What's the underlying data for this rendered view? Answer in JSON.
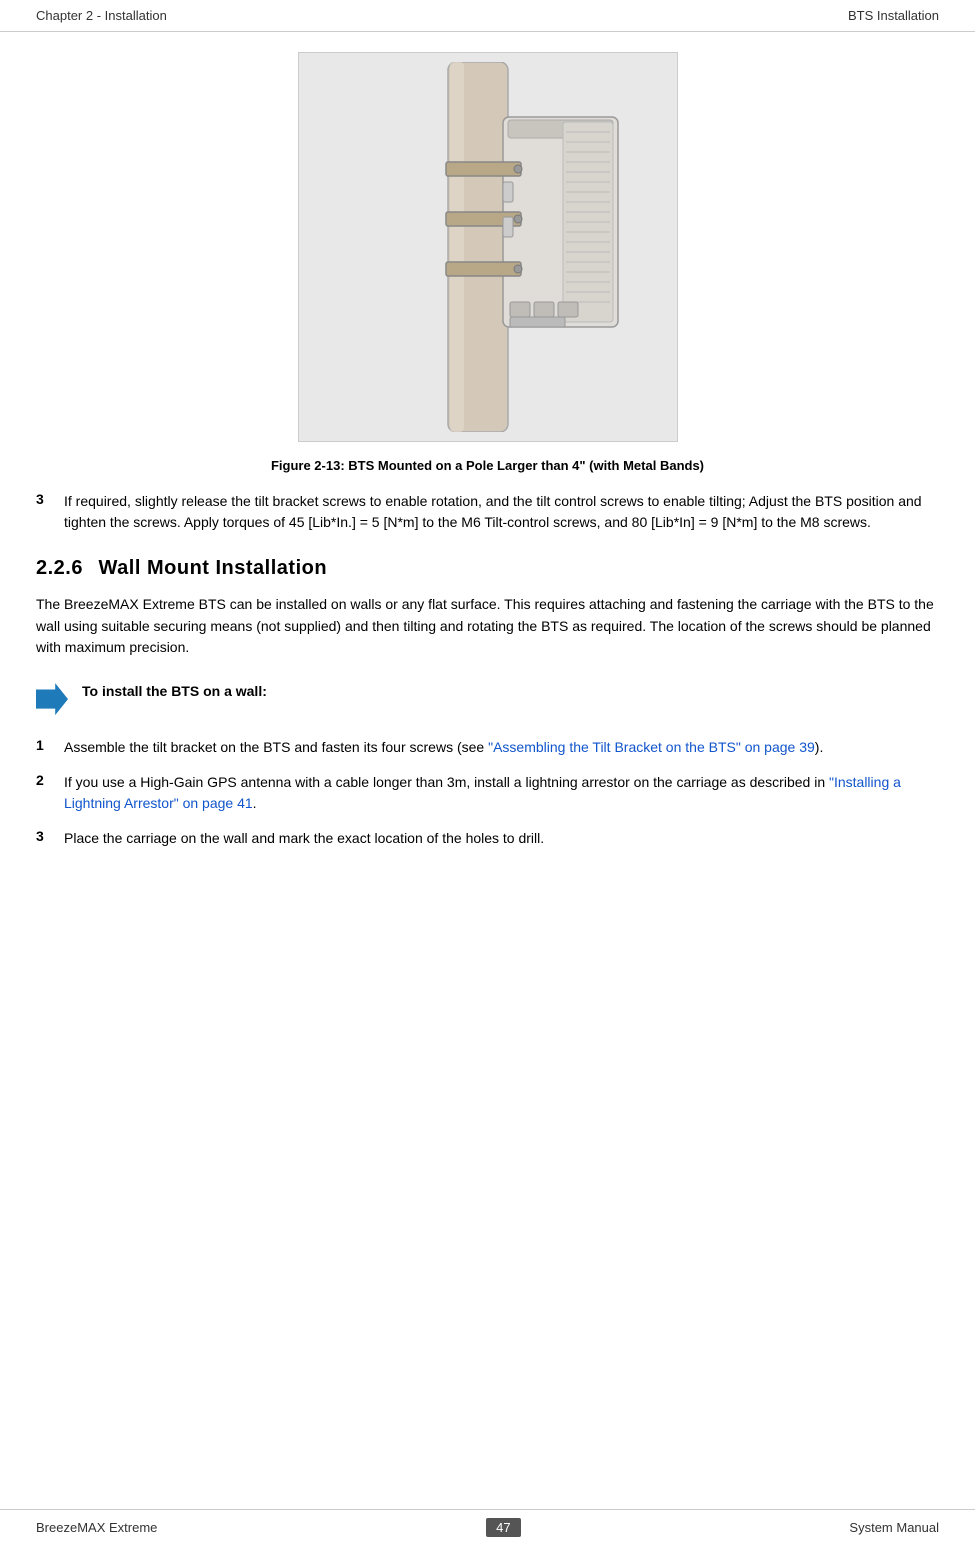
{
  "header": {
    "left": "Chapter 2 - Installation",
    "right": "BTS Installation"
  },
  "footer": {
    "left": "BreezeMAX Extreme",
    "center": "47",
    "right": "System Manual"
  },
  "figure": {
    "caption": "Figure 2-13: BTS Mounted on a Pole Larger than 4\" (with Metal Bands)"
  },
  "intro_steps": [
    {
      "number": "3",
      "text": "If required, slightly release the tilt bracket screws to enable rotation, and the tilt control screws to enable tilting; Adjust the BTS position and tighten the screws. Apply torques of 45 [Lib*In.] = 5 [N*m] to the M6 Tilt-control screws, and 80 [Lib*In] = 9 [N*m] to the M8 screws."
    }
  ],
  "section": {
    "number": "2.2.6",
    "title": "Wall Mount Installation"
  },
  "body_paragraph": "The BreezeMAX Extreme BTS can be installed on walls or any flat surface. This requires attaching and fastening the carriage with the BTS to the wall using suitable securing means (not supplied) and then tilting and rotating the BTS as required. The location of the screws should be planned with maximum precision.",
  "tip": {
    "label": "To install the BTS on a wall:"
  },
  "wall_steps": [
    {
      "number": "1",
      "text_before": "Assemble the tilt bracket on the BTS and fasten its four screws (see ",
      "link": "\"Assembling the Tilt Bracket on the BTS\" on page 39",
      "text_after": ")."
    },
    {
      "number": "2",
      "text_before": "If you use a High-Gain GPS antenna with a cable longer than 3m, install a lightning arrestor on the carriage as described in ",
      "link": "\"Installing a Lightning Arrestor\" on page 41",
      "text_after": "."
    },
    {
      "number": "3",
      "text": "Place the carriage on the wall and mark the exact location of the holes to drill."
    }
  ]
}
